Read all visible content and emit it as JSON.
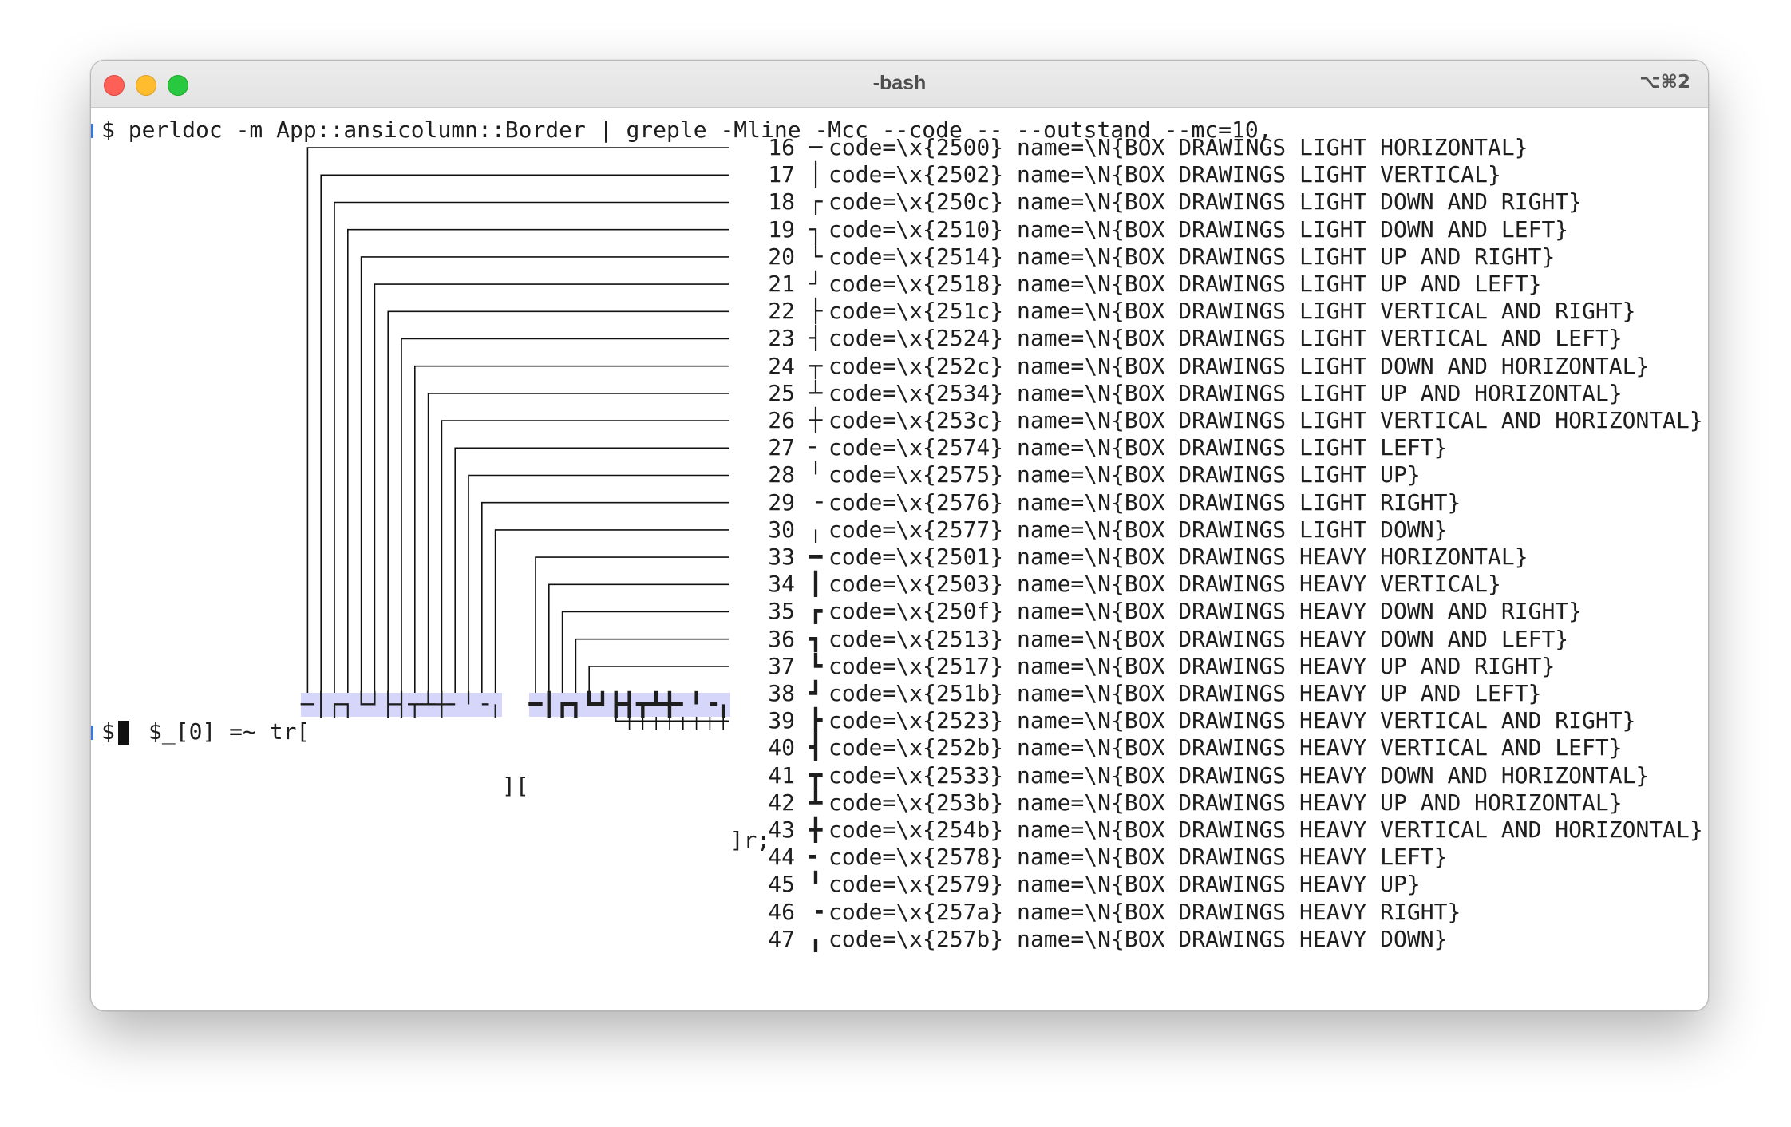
{
  "window": {
    "title": "-bash",
    "shortcut": "⌥⌘2"
  },
  "terminal": {
    "command": "$ perldoc -m App::ansicolumn::Border | greple -Mline -Mcc --code -- --outstand --mc=10,",
    "rows": [
      {
        "num": "16",
        "glyph": "─",
        "text": "code=\\x{2500} name=\\N{BOX DRAWINGS LIGHT HORIZONTAL}"
      },
      {
        "num": "17",
        "glyph": "│",
        "text": "code=\\x{2502} name=\\N{BOX DRAWINGS LIGHT VERTICAL}"
      },
      {
        "num": "18",
        "glyph": "┌",
        "text": "code=\\x{250c} name=\\N{BOX DRAWINGS LIGHT DOWN AND RIGHT}"
      },
      {
        "num": "19",
        "glyph": "┐",
        "text": "code=\\x{2510} name=\\N{BOX DRAWINGS LIGHT DOWN AND LEFT}"
      },
      {
        "num": "20",
        "glyph": "└",
        "text": "code=\\x{2514} name=\\N{BOX DRAWINGS LIGHT UP AND RIGHT}"
      },
      {
        "num": "21",
        "glyph": "┘",
        "text": "code=\\x{2518} name=\\N{BOX DRAWINGS LIGHT UP AND LEFT}"
      },
      {
        "num": "22",
        "glyph": "├",
        "text": "code=\\x{251c} name=\\N{BOX DRAWINGS LIGHT VERTICAL AND RIGHT}"
      },
      {
        "num": "23",
        "glyph": "┤",
        "text": "code=\\x{2524} name=\\N{BOX DRAWINGS LIGHT VERTICAL AND LEFT}"
      },
      {
        "num": "24",
        "glyph": "┬",
        "text": "code=\\x{252c} name=\\N{BOX DRAWINGS LIGHT DOWN AND HORIZONTAL}"
      },
      {
        "num": "25",
        "glyph": "┴",
        "text": "code=\\x{2534} name=\\N{BOX DRAWINGS LIGHT UP AND HORIZONTAL}"
      },
      {
        "num": "26",
        "glyph": "┼",
        "text": "code=\\x{253c} name=\\N{BOX DRAWINGS LIGHT VERTICAL AND HORIZONTAL}"
      },
      {
        "num": "27",
        "glyph": "╴",
        "text": "code=\\x{2574} name=\\N{BOX DRAWINGS LIGHT LEFT}"
      },
      {
        "num": "28",
        "glyph": "╵",
        "text": "code=\\x{2575} name=\\N{BOX DRAWINGS LIGHT UP}"
      },
      {
        "num": "29",
        "glyph": "╶",
        "text": "code=\\x{2576} name=\\N{BOX DRAWINGS LIGHT RIGHT}"
      },
      {
        "num": "30",
        "glyph": "╷",
        "text": "code=\\x{2577} name=\\N{BOX DRAWINGS LIGHT DOWN}"
      },
      {
        "num": "33",
        "glyph": "━",
        "text": "code=\\x{2501} name=\\N{BOX DRAWINGS HEAVY HORIZONTAL}"
      },
      {
        "num": "34",
        "glyph": "┃",
        "text": "code=\\x{2503} name=\\N{BOX DRAWINGS HEAVY VERTICAL}"
      },
      {
        "num": "35",
        "glyph": "┏",
        "text": "code=\\x{250f} name=\\N{BOX DRAWINGS HEAVY DOWN AND RIGHT}"
      },
      {
        "num": "36",
        "glyph": "┓",
        "text": "code=\\x{2513} name=\\N{BOX DRAWINGS HEAVY DOWN AND LEFT}"
      },
      {
        "num": "37",
        "glyph": "┗",
        "text": "code=\\x{2517} name=\\N{BOX DRAWINGS HEAVY UP AND RIGHT}"
      },
      {
        "num": "38",
        "glyph": "┛",
        "text": "code=\\x{251b} name=\\N{BOX DRAWINGS HEAVY UP AND LEFT}"
      },
      {
        "num": "39",
        "glyph": "┣",
        "text": "code=\\x{2523} name=\\N{BOX DRAWINGS HEAVY VERTICAL AND RIGHT}"
      },
      {
        "num": "40",
        "glyph": "┫",
        "text": "code=\\x{252b} name=\\N{BOX DRAWINGS HEAVY VERTICAL AND LEFT}"
      },
      {
        "num": "41",
        "glyph": "┳",
        "text": "code=\\x{2533} name=\\N{BOX DRAWINGS HEAVY DOWN AND HORIZONTAL}"
      },
      {
        "num": "42",
        "glyph": "┻",
        "text": "code=\\x{253b} name=\\N{BOX DRAWINGS HEAVY UP AND HORIZONTAL}"
      },
      {
        "num": "43",
        "glyph": "╋",
        "text": "code=\\x{254b} name=\\N{BOX DRAWINGS HEAVY VERTICAL AND HORIZONTAL}"
      },
      {
        "num": "44",
        "glyph": "╸",
        "text": "code=\\x{2578} name=\\N{BOX DRAWINGS HEAVY LEFT}"
      },
      {
        "num": "45",
        "glyph": "╹",
        "text": "code=\\x{2579} name=\\N{BOX DRAWINGS HEAVY UP}"
      },
      {
        "num": "46",
        "glyph": "╺",
        "text": "code=\\x{257a} name=\\N{BOX DRAWINGS HEAVY RIGHT}"
      },
      {
        "num": "47",
        "glyph": "╻",
        "text": "code=\\x{257b} name=\\N{BOX DRAWINGS HEAVY DOWN}"
      }
    ],
    "tr_prefix": "$_[0] =~ tr[",
    "tr_light_chars": "─│┌┐└┘├┤┬┴┼╴╵╶╷",
    "tr_middle": "][",
    "tr_heavy_chars": "━┃┏┓┗┛┣┫┳┻╋╸╹╺╻",
    "tr_suffix": "]r;",
    "prompt": "$"
  },
  "colors": {
    "highlight": "#d6d6fa",
    "prompt_marker": "#3a76d8"
  }
}
